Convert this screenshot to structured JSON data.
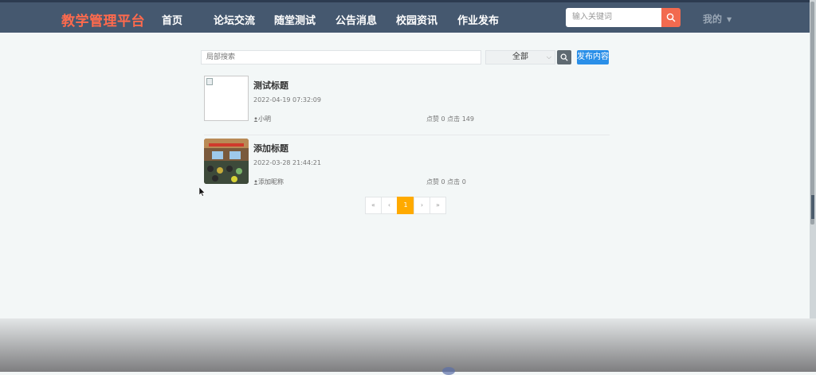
{
  "header": {
    "brand": "教学管理平台",
    "nav": [
      {
        "label": "首页"
      },
      {
        "label": "论坛交流"
      },
      {
        "label": "随堂测试"
      },
      {
        "label": "公告消息"
      },
      {
        "label": "校园资讯"
      },
      {
        "label": "作业发布"
      }
    ],
    "search_placeholder": "输入关键词",
    "user_menu": "我的"
  },
  "toolbar": {
    "local_search_placeholder": "局部搜索",
    "category_selected": "全部",
    "publish_label": "发布内容"
  },
  "posts": [
    {
      "title": "测试标题",
      "date": "2022-04-19 07:32:09",
      "author": "小明",
      "stats": "点赞 0 点击 149",
      "image": "broken-image"
    },
    {
      "title": "添加标题",
      "date": "2022-03-28 21:44:21",
      "author": "添加昵称",
      "stats": "点赞 0 点击 0",
      "image": "classroom-photo"
    }
  ],
  "pagination": {
    "first": "«",
    "prev": "‹",
    "current": "1",
    "next": "›",
    "last": "»"
  },
  "colors": {
    "header_bg": "#45586f",
    "brand": "#ff6a4d",
    "search_button": "#f26a4f",
    "publish_button": "#2a8fe8",
    "pager_active": "#ffaa00"
  }
}
